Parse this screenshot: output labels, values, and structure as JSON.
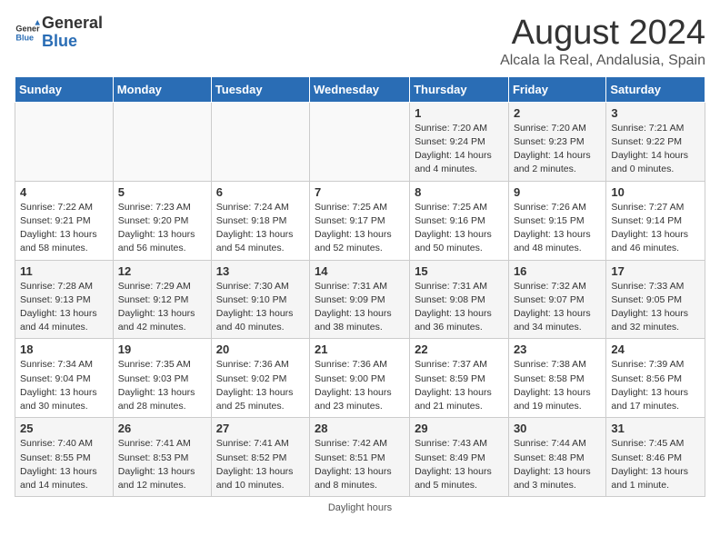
{
  "header": {
    "logo_general": "General",
    "logo_blue": "Blue",
    "month_title": "August 2024",
    "location": "Alcala la Real, Andalusia, Spain"
  },
  "columns": [
    "Sunday",
    "Monday",
    "Tuesday",
    "Wednesday",
    "Thursday",
    "Friday",
    "Saturday"
  ],
  "weeks": [
    [
      {
        "day": "",
        "info": ""
      },
      {
        "day": "",
        "info": ""
      },
      {
        "day": "",
        "info": ""
      },
      {
        "day": "",
        "info": ""
      },
      {
        "day": "1",
        "info": "Sunrise: 7:20 AM\nSunset: 9:24 PM\nDaylight: 14 hours and 4 minutes."
      },
      {
        "day": "2",
        "info": "Sunrise: 7:20 AM\nSunset: 9:23 PM\nDaylight: 14 hours and 2 minutes."
      },
      {
        "day": "3",
        "info": "Sunrise: 7:21 AM\nSunset: 9:22 PM\nDaylight: 14 hours and 0 minutes."
      }
    ],
    [
      {
        "day": "4",
        "info": "Sunrise: 7:22 AM\nSunset: 9:21 PM\nDaylight: 13 hours and 58 minutes."
      },
      {
        "day": "5",
        "info": "Sunrise: 7:23 AM\nSunset: 9:20 PM\nDaylight: 13 hours and 56 minutes."
      },
      {
        "day": "6",
        "info": "Sunrise: 7:24 AM\nSunset: 9:18 PM\nDaylight: 13 hours and 54 minutes."
      },
      {
        "day": "7",
        "info": "Sunrise: 7:25 AM\nSunset: 9:17 PM\nDaylight: 13 hours and 52 minutes."
      },
      {
        "day": "8",
        "info": "Sunrise: 7:25 AM\nSunset: 9:16 PM\nDaylight: 13 hours and 50 minutes."
      },
      {
        "day": "9",
        "info": "Sunrise: 7:26 AM\nSunset: 9:15 PM\nDaylight: 13 hours and 48 minutes."
      },
      {
        "day": "10",
        "info": "Sunrise: 7:27 AM\nSunset: 9:14 PM\nDaylight: 13 hours and 46 minutes."
      }
    ],
    [
      {
        "day": "11",
        "info": "Sunrise: 7:28 AM\nSunset: 9:13 PM\nDaylight: 13 hours and 44 minutes."
      },
      {
        "day": "12",
        "info": "Sunrise: 7:29 AM\nSunset: 9:12 PM\nDaylight: 13 hours and 42 minutes."
      },
      {
        "day": "13",
        "info": "Sunrise: 7:30 AM\nSunset: 9:10 PM\nDaylight: 13 hours and 40 minutes."
      },
      {
        "day": "14",
        "info": "Sunrise: 7:31 AM\nSunset: 9:09 PM\nDaylight: 13 hours and 38 minutes."
      },
      {
        "day": "15",
        "info": "Sunrise: 7:31 AM\nSunset: 9:08 PM\nDaylight: 13 hours and 36 minutes."
      },
      {
        "day": "16",
        "info": "Sunrise: 7:32 AM\nSunset: 9:07 PM\nDaylight: 13 hours and 34 minutes."
      },
      {
        "day": "17",
        "info": "Sunrise: 7:33 AM\nSunset: 9:05 PM\nDaylight: 13 hours and 32 minutes."
      }
    ],
    [
      {
        "day": "18",
        "info": "Sunrise: 7:34 AM\nSunset: 9:04 PM\nDaylight: 13 hours and 30 minutes."
      },
      {
        "day": "19",
        "info": "Sunrise: 7:35 AM\nSunset: 9:03 PM\nDaylight: 13 hours and 28 minutes."
      },
      {
        "day": "20",
        "info": "Sunrise: 7:36 AM\nSunset: 9:02 PM\nDaylight: 13 hours and 25 minutes."
      },
      {
        "day": "21",
        "info": "Sunrise: 7:36 AM\nSunset: 9:00 PM\nDaylight: 13 hours and 23 minutes."
      },
      {
        "day": "22",
        "info": "Sunrise: 7:37 AM\nSunset: 8:59 PM\nDaylight: 13 hours and 21 minutes."
      },
      {
        "day": "23",
        "info": "Sunrise: 7:38 AM\nSunset: 8:58 PM\nDaylight: 13 hours and 19 minutes."
      },
      {
        "day": "24",
        "info": "Sunrise: 7:39 AM\nSunset: 8:56 PM\nDaylight: 13 hours and 17 minutes."
      }
    ],
    [
      {
        "day": "25",
        "info": "Sunrise: 7:40 AM\nSunset: 8:55 PM\nDaylight: 13 hours and 14 minutes."
      },
      {
        "day": "26",
        "info": "Sunrise: 7:41 AM\nSunset: 8:53 PM\nDaylight: 13 hours and 12 minutes."
      },
      {
        "day": "27",
        "info": "Sunrise: 7:41 AM\nSunset: 8:52 PM\nDaylight: 13 hours and 10 minutes."
      },
      {
        "day": "28",
        "info": "Sunrise: 7:42 AM\nSunset: 8:51 PM\nDaylight: 13 hours and 8 minutes."
      },
      {
        "day": "29",
        "info": "Sunrise: 7:43 AM\nSunset: 8:49 PM\nDaylight: 13 hours and 5 minutes."
      },
      {
        "day": "30",
        "info": "Sunrise: 7:44 AM\nSunset: 8:48 PM\nDaylight: 13 hours and 3 minutes."
      },
      {
        "day": "31",
        "info": "Sunrise: 7:45 AM\nSunset: 8:46 PM\nDaylight: 13 hours and 1 minute."
      }
    ]
  ],
  "footer": "Daylight hours"
}
